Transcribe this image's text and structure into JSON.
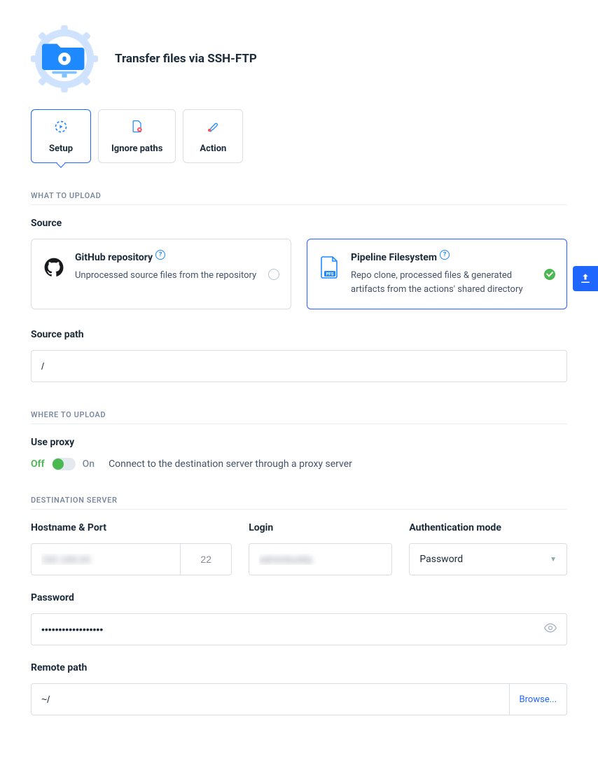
{
  "header": {
    "title": "Transfer files via SSH-FTP"
  },
  "tabs": [
    {
      "label": "Setup",
      "active": true
    },
    {
      "label": "Ignore paths",
      "active": false
    },
    {
      "label": "Action",
      "active": false
    }
  ],
  "sections": {
    "what_to_upload": "WHAT TO UPLOAD",
    "where_to_upload": "WHERE TO UPLOAD",
    "destination_server": "DESTINATION SERVER"
  },
  "source": {
    "label": "Source",
    "github": {
      "title": "GitHub repository",
      "desc": "Unprocessed source files from the repository"
    },
    "pipeline": {
      "title": "Pipeline Filesystem",
      "desc": "Repo clone, processed files & generated artifacts from the actions' shared directory"
    }
  },
  "source_path": {
    "label": "Source path",
    "value": "/"
  },
  "proxy": {
    "label": "Use proxy",
    "off": "Off",
    "on": "On",
    "help": "Connect to the destination server through a proxy server"
  },
  "dest": {
    "host_label": "Hostname & Port",
    "port": "22",
    "login_label": "Login",
    "auth_label": "Authentication mode",
    "auth_value": "Password",
    "password_label": "Password",
    "password_value": "••••••••••••••••••",
    "remote_label": "Remote path",
    "remote_value": "~/",
    "browse": "Browse..."
  }
}
